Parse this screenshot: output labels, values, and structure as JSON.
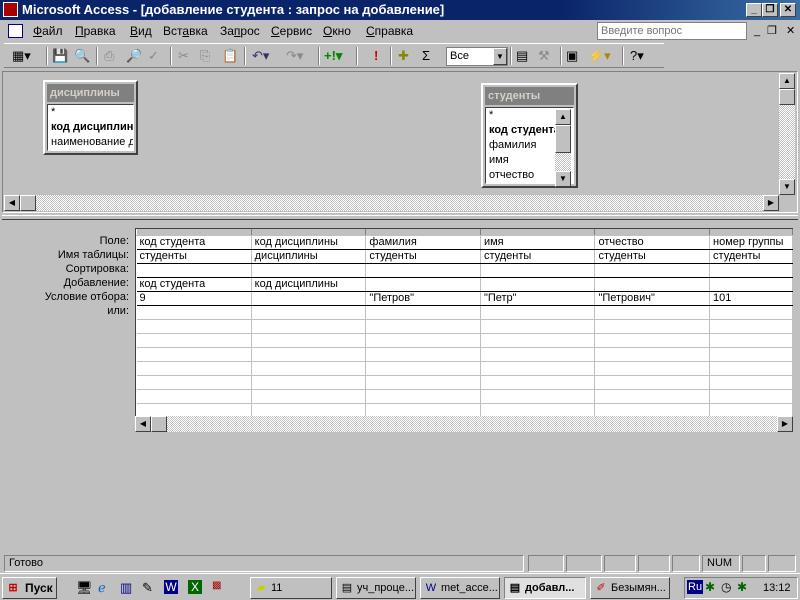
{
  "window": {
    "title": "Microsoft Access - [добавление студента : запрос на добавление]"
  },
  "menu": {
    "items": [
      {
        "pre": "",
        "u": "Ф",
        "post": "айл"
      },
      {
        "pre": "",
        "u": "П",
        "post": "равка"
      },
      {
        "pre": "",
        "u": "В",
        "post": "ид"
      },
      {
        "pre": "Вст",
        "u": "а",
        "post": "вка"
      },
      {
        "pre": "За",
        "u": "п",
        "post": "рос"
      },
      {
        "pre": "",
        "u": "С",
        "post": "ервис"
      },
      {
        "pre": "",
        "u": "О",
        "post": "кно"
      },
      {
        "pre": "",
        "u": "С",
        "post": "правка"
      }
    ],
    "help_placeholder": "Введите вопрос"
  },
  "toolbar": {
    "top_values": "Все"
  },
  "tables": [
    {
      "name": "дисциплины",
      "fields": [
        "*",
        "код дисциплины",
        "наименование дисциплины"
      ],
      "key": "код дисциплины"
    },
    {
      "name": "студенты",
      "fields": [
        "*",
        "код студента",
        "фамилия",
        "имя",
        "отчество"
      ],
      "key": "код студента"
    }
  ],
  "grid": {
    "row_labels": [
      "Поле:",
      "Имя таблицы:",
      "Сортировка:",
      "Добавление:",
      "Условие отбора:",
      "или:"
    ],
    "columns": [
      {
        "field": "код студента",
        "table": "студенты",
        "sort": "",
        "append": "код студента",
        "criteria": "9"
      },
      {
        "field": "код дисциплины",
        "table": "дисциплины",
        "sort": "",
        "append": "код дисциплины",
        "criteria": ""
      },
      {
        "field": "фамилия",
        "table": "студенты",
        "sort": "",
        "append": "",
        "criteria": "\"Петров\""
      },
      {
        "field": "имя",
        "table": "студенты",
        "sort": "",
        "append": "",
        "criteria": "\"Петр\""
      },
      {
        "field": "отчество",
        "table": "студенты",
        "sort": "",
        "append": "",
        "criteria": "\"Петрович\""
      },
      {
        "field": "номер группы",
        "table": "студенты",
        "sort": "",
        "append": "",
        "criteria": "101"
      }
    ]
  },
  "status": {
    "text": "Готово",
    "num": "NUM"
  },
  "taskbar": {
    "start": "Пуск",
    "tasks": [
      "11",
      "уч_проце...",
      "met_acce...",
      "добавл...",
      "Безымян..."
    ],
    "lang": "Ru",
    "clock": "13:12"
  }
}
